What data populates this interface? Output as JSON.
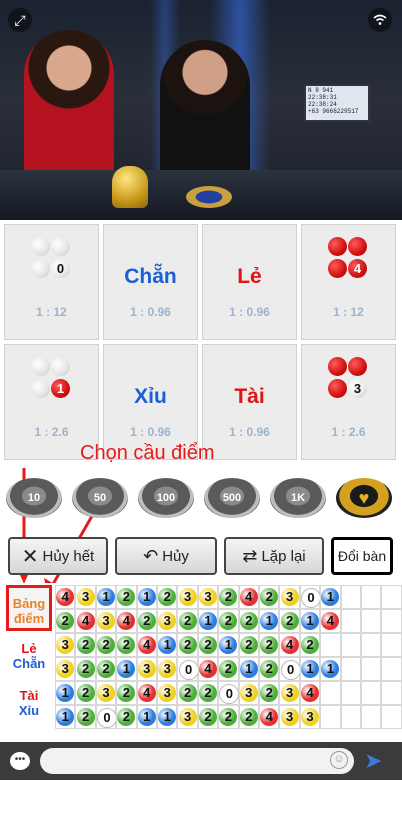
{
  "video": {
    "fullscreen_icon": "fullscreen-icon",
    "signal_icon": "wifi-signal-icon",
    "monitor_lines": [
      "N 8 941",
      "22:38:31",
      "22:38:24",
      "+63 9666229517"
    ]
  },
  "bet_options": [
    {
      "label": "",
      "pattern": "white-white-white-0",
      "badge": "0",
      "odds": "1 : 12"
    },
    {
      "label": "Chẵn",
      "odds": "1 : 0.96",
      "color": "#1a5fd6"
    },
    {
      "label": "Lẻ",
      "odds": "1 : 0.96",
      "color": "#e01414"
    },
    {
      "label": "",
      "pattern": "red-red-red-4",
      "badge": "4",
      "odds": "1 : 12"
    },
    {
      "label": "",
      "pattern": "white-white-white-red1",
      "badge": "1",
      "odds": "1 : 2.6"
    },
    {
      "label": "Xỉu",
      "odds": "1 : 0.96",
      "color": "#1a5fd6"
    },
    {
      "label": "Tài",
      "odds": "1 : 0.96",
      "color": "#e01414"
    },
    {
      "label": "",
      "pattern": "red-red-red-white3",
      "badge": "3",
      "odds": "1 : 2.6"
    }
  ],
  "annotation": "Chọn cầu điểm",
  "chips": [
    "10",
    "50",
    "100",
    "500",
    "1K",
    "♥"
  ],
  "actions": {
    "cancel_all": "Hủy hết",
    "cancel": "Hủy",
    "repeat": "Lặp lại",
    "change_table": "Đổi bàn"
  },
  "road_tabs": {
    "points_line1": "Bảng",
    "points_line2": "điểm",
    "odd_even_line1": "Lẻ",
    "odd_even_line2": "Chẵn",
    "big_small_line1": "Tài",
    "big_small_line2": "Xỉu"
  },
  "road_rows": [
    [
      "4",
      "3",
      "1",
      "2",
      "1",
      "2",
      "3",
      "3",
      "2",
      "4",
      "2",
      "3",
      "0",
      "1"
    ],
    [
      "2",
      "4",
      "3",
      "4",
      "2",
      "3",
      "2",
      "1",
      "2",
      "2",
      "1",
      "2",
      "1",
      "4"
    ],
    [
      "3",
      "2",
      "2",
      "2",
      "4",
      "1",
      "2",
      "2",
      "1",
      "2",
      "2",
      "4",
      "2"
    ],
    [
      "3",
      "2",
      "2",
      "1",
      "3",
      "3",
      "0",
      "4",
      "2",
      "1",
      "2",
      "0",
      "1",
      "1"
    ],
    [
      "1",
      "2",
      "3",
      "2",
      "4",
      "3",
      "2",
      "2",
      "0",
      "3",
      "2",
      "3",
      "4"
    ],
    [
      "1",
      "2",
      "0",
      "2",
      "1",
      "1",
      "3",
      "2",
      "2",
      "2",
      "4",
      "3",
      "3"
    ]
  ],
  "road_colors": {
    "0": "#ffffff",
    "1": "#2b7de0",
    "2": "#4caf38",
    "3": "#f0d020",
    "4": "#e53030"
  },
  "chat": {
    "placeholder": "",
    "chat_icon": "chat-bubble-icon",
    "emoji_icon": "emoji-icon",
    "send_icon": "send-icon"
  }
}
